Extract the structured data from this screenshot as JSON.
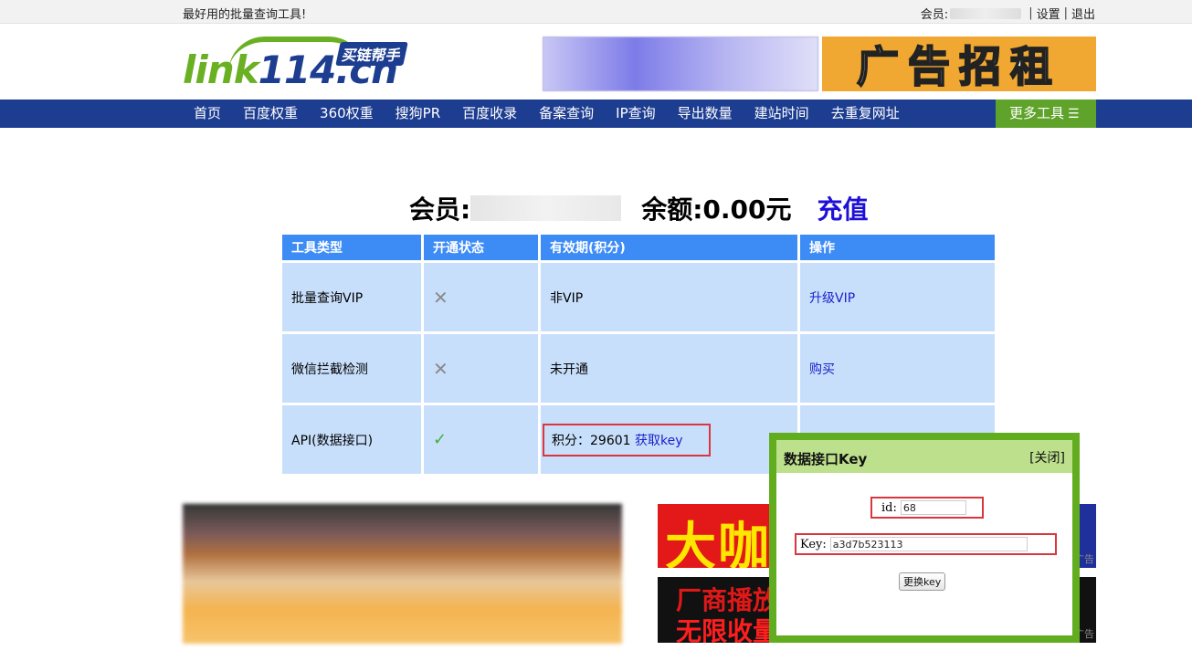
{
  "topbar": {
    "slogan": "最好用的批量查询工具!",
    "member_label": "会员:",
    "settings": "设置",
    "logout": "退出",
    "sep": "|"
  },
  "logo": {
    "green": "link",
    "blue": "114.cn",
    "badge": "买链帮手"
  },
  "ads": {
    "banner_right": "广告招租"
  },
  "nav": {
    "items": [
      "首页",
      "百度权重",
      "360权重",
      "搜狗PR",
      "百度收录",
      "备案查询",
      "IP查询",
      "导出数量",
      "建站时间",
      "去重复网址"
    ],
    "more": "更多工具"
  },
  "member": {
    "label": "会员:",
    "balance": "余额:0.00元",
    "recharge": "充值"
  },
  "table": {
    "headers": [
      "工具类型",
      "开通状态",
      "有效期(积分)",
      "操作"
    ],
    "rows": [
      {
        "type": "批量查询VIP",
        "status": "✕",
        "validity": "非VIP",
        "action": "升级VIP"
      },
      {
        "type": "微信拦截检测",
        "status": "✕",
        "validity": "未开通",
        "action": "购买"
      },
      {
        "type": "API(数据接口)",
        "status": "✓",
        "points_label": "积分：29601",
        "get_key": "获取key",
        "action": ""
      }
    ]
  },
  "right_ads": {
    "top_text": "大咖",
    "line1": "厂商播放",
    "line2": "无限收量",
    "tag": "广告"
  },
  "popup": {
    "title": "数据接口Key",
    "close": "[关闭]",
    "id_label": "id:",
    "id_value": "68",
    "key_label": "Key:",
    "key_value": "a3d7b523113",
    "change_button": "更换key"
  }
}
